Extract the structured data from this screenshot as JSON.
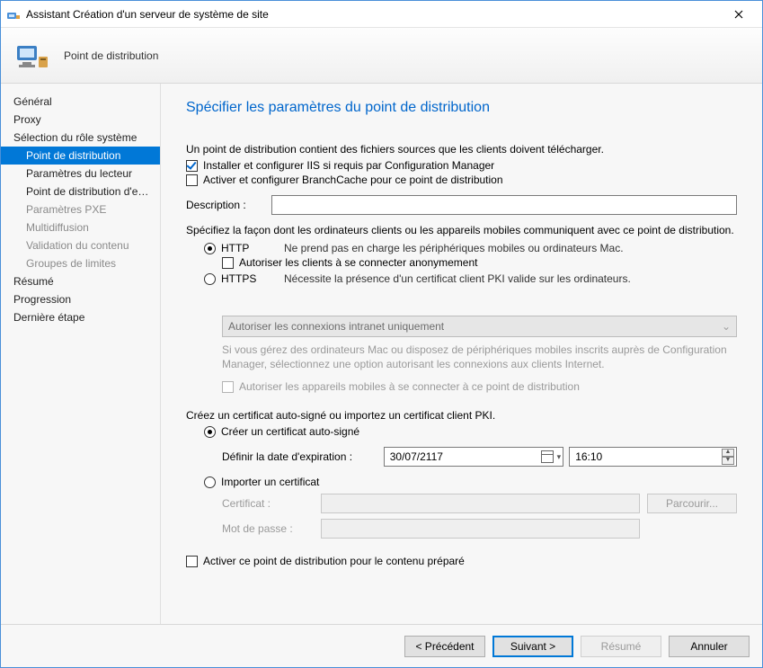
{
  "window": {
    "title": "Assistant Création d'un serveur de système de site"
  },
  "banner": {
    "title": "Point de distribution"
  },
  "sidebar": {
    "items": [
      {
        "label": "Général",
        "selected": false,
        "sub": false,
        "disabled": false
      },
      {
        "label": "Proxy",
        "selected": false,
        "sub": false,
        "disabled": false
      },
      {
        "label": "Sélection du rôle système",
        "selected": false,
        "sub": false,
        "disabled": false
      },
      {
        "label": "Point de distribution",
        "selected": true,
        "sub": true,
        "disabled": false
      },
      {
        "label": "Paramètres du lecteur",
        "selected": false,
        "sub": true,
        "disabled": false
      },
      {
        "label": "Point de distribution d'extraction",
        "selected": false,
        "sub": true,
        "disabled": false
      },
      {
        "label": "Paramètres PXE",
        "selected": false,
        "sub": true,
        "disabled": true
      },
      {
        "label": "Multidiffusion",
        "selected": false,
        "sub": true,
        "disabled": true
      },
      {
        "label": "Validation du contenu",
        "selected": false,
        "sub": true,
        "disabled": true
      },
      {
        "label": "Groupes de limites",
        "selected": false,
        "sub": true,
        "disabled": true
      },
      {
        "label": "Résumé",
        "selected": false,
        "sub": false,
        "disabled": false
      },
      {
        "label": "Progression",
        "selected": false,
        "sub": false,
        "disabled": false
      },
      {
        "label": "Dernière étape",
        "selected": false,
        "sub": false,
        "disabled": false
      }
    ]
  },
  "main": {
    "heading": "Spécifier les paramètres du point de distribution",
    "intro": "Un point de distribution contient des fichiers sources que les clients doivent télécharger.",
    "chk_iis": "Installer et configurer IIS si requis par Configuration Manager",
    "chk_branchcache": "Activer et configurer BranchCache pour ce point de distribution",
    "description_label": "Description :",
    "description_value": "",
    "comm_intro": "Spécifiez la façon dont les ordinateurs clients ou les appareils mobiles communiquent avec ce point de distribution.",
    "http": {
      "label": "HTTP",
      "note": "Ne prend pas en charge les périphériques mobiles ou ordinateurs Mac.",
      "anon": "Autoriser les clients à se connecter anonymement"
    },
    "https": {
      "label": "HTTPS",
      "note": "Nécessite la présence d'un certificat client PKI valide sur les ordinateurs."
    },
    "intranet_dropdown": "Autoriser les connexions intranet uniquement",
    "intranet_help": "Si vous gérez des ordinateurs Mac ou disposez de périphériques mobiles inscrits auprès de Configuration Manager, sélectionnez une option autorisant les connexions aux clients Internet.",
    "mobile_chk": "Autoriser les appareils mobiles à se connecter à ce point de distribution",
    "cert_intro": "Créez un certificat auto-signé ou importez un certificat client PKI.",
    "cert_self": "Créer un certificat auto-signé",
    "expiry_label": "Définir la date d'expiration :",
    "expiry_date": "30/07/2117",
    "expiry_time": "16:10",
    "cert_import": "Importer un certificat",
    "cert_label": "Certificat :",
    "cert_pwd": "Mot de passe :",
    "browse": "Parcourir...",
    "prestage": "Activer ce point de distribution pour le contenu préparé"
  },
  "footer": {
    "prev": "< Précédent",
    "next": "Suivant >",
    "summary": "Résumé",
    "cancel": "Annuler"
  }
}
